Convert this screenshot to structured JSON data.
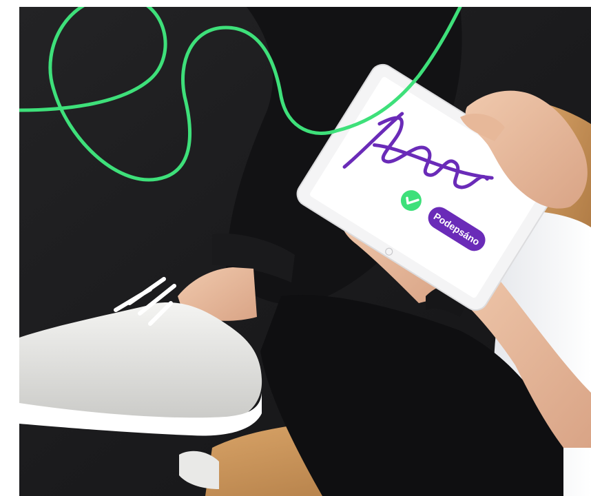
{
  "tablet_screen": {
    "status_button_label": "Podepsáno",
    "signature_name_art": "Novák"
  },
  "colors": {
    "accent_green": "#3ee07a",
    "signature_purple": "#6a2bb8",
    "background_dark": "#1f1f21",
    "wood": "#c8925a"
  }
}
